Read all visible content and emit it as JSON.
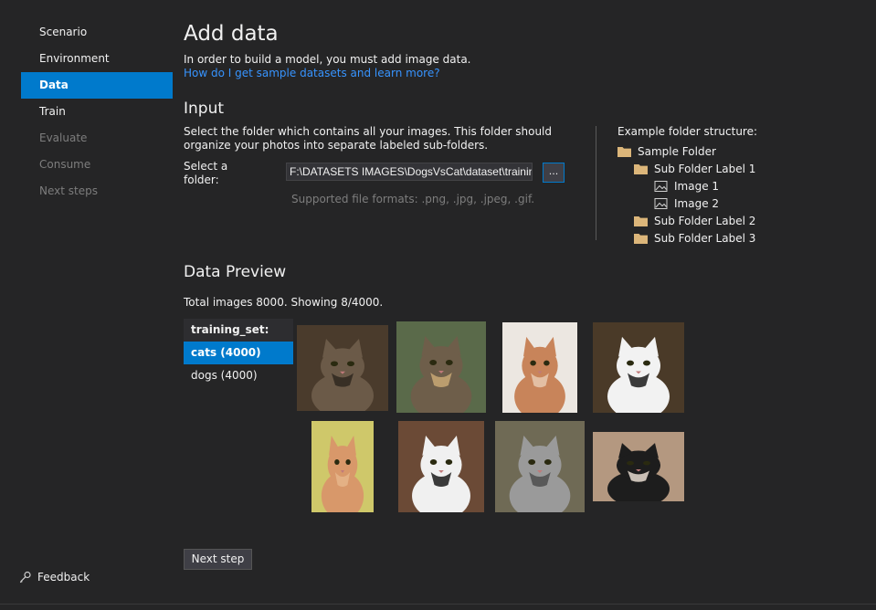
{
  "sidebar": {
    "items": [
      {
        "label": "Scenario",
        "state": "normal"
      },
      {
        "label": "Environment",
        "state": "normal"
      },
      {
        "label": "Data",
        "state": "active"
      },
      {
        "label": "Train",
        "state": "normal"
      },
      {
        "label": "Evaluate",
        "state": "disabled"
      },
      {
        "label": "Consume",
        "state": "disabled"
      },
      {
        "label": "Next steps",
        "state": "disabled"
      }
    ],
    "feedback_label": "Feedback"
  },
  "header": {
    "title": "Add data",
    "subtitle": "In order to build a model, you must add image data.",
    "help_link": "How do I get sample datasets and learn more?"
  },
  "input": {
    "heading": "Input",
    "description": "Select the folder which contains all your images. This folder should organize your photos into separate labeled sub-folders.",
    "select_label": "Select a folder:",
    "folder_path": "F:\\DATASETS IMAGES\\DogsVsCat\\dataset\\training_set",
    "browse_label": "...",
    "supported_formats": "Supported file formats: .png, .jpg, .jpeg, .gif."
  },
  "example": {
    "title": "Example folder structure:",
    "tree": [
      {
        "label": "Sample Folder",
        "type": "folder",
        "level": 0
      },
      {
        "label": "Sub Folder Label 1",
        "type": "folder",
        "level": 1
      },
      {
        "label": "Image 1",
        "type": "image",
        "level": 2
      },
      {
        "label": "Image 2",
        "type": "image",
        "level": 2
      },
      {
        "label": "Sub Folder Label 2",
        "type": "folder",
        "level": 1
      },
      {
        "label": "Sub Folder Label 3",
        "type": "folder",
        "level": 1
      }
    ]
  },
  "preview": {
    "heading": "Data Preview",
    "info": "Total images 8000. Showing 8/4000.",
    "list_header": "training_set:",
    "categories": [
      {
        "label": "cats (4000)",
        "active": true
      },
      {
        "label": "dogs (4000)",
        "active": false
      }
    ],
    "thumbnails": [
      {
        "name": "cat-thumbnail-1",
        "bg": "#4a3b2c",
        "fur": "#6b5a48",
        "accent": "#2f2820"
      },
      {
        "name": "cat-thumbnail-2",
        "bg": "#5a6a4a",
        "fur": "#6e5e4a",
        "accent": "#c9a874"
      },
      {
        "name": "cat-thumbnail-3",
        "bg": "#ece7e1",
        "fur": "#c8845a",
        "accent": "#e7c9b0"
      },
      {
        "name": "cat-thumbnail-4",
        "bg": "#4a3a28",
        "fur": "#f2f2f2",
        "accent": "#1b1b1b"
      },
      {
        "name": "cat-thumbnail-5",
        "bg": "#cfc86a",
        "fur": "#d8986a",
        "accent": "#e6b58a"
      },
      {
        "name": "cat-thumbnail-6",
        "bg": "#6b4a36",
        "fur": "#f0f0f0",
        "accent": "#1a1a1a"
      },
      {
        "name": "cat-thumbnail-7",
        "bg": "#6f6a55",
        "fur": "#9a9a9a",
        "accent": "#4e4e4e"
      },
      {
        "name": "cat-thumbnail-8",
        "bg": "#b49880",
        "fur": "#1d1d1d",
        "accent": "#e8dcd0"
      }
    ]
  },
  "footer": {
    "next_label": "Next step"
  },
  "colors": {
    "accent": "#007acc",
    "link": "#3794ff",
    "folder": "#dcb67a",
    "background": "#252526"
  }
}
